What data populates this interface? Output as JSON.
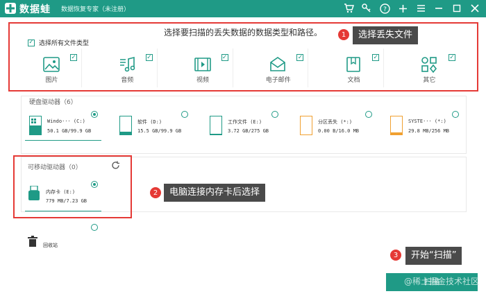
{
  "app": {
    "name": "数据蛙",
    "subtitle": "数据恢复专家（未注册）"
  },
  "titlebar": {
    "icons": [
      "cart-icon",
      "key-icon",
      "help-icon",
      "plus-icon",
      "menu-icon",
      "minimize-icon",
      "maximize-icon",
      "close-icon"
    ]
  },
  "scan": {
    "title": "选择要扫描的丢失数据的数据类型和路径。",
    "select_all": "选择所有文件类型",
    "types": [
      {
        "label": "图片",
        "icon": "image-icon",
        "checked": true
      },
      {
        "label": "音频",
        "icon": "music-icon",
        "checked": true
      },
      {
        "label": "视频",
        "icon": "video-icon",
        "checked": true
      },
      {
        "label": "电子邮件",
        "icon": "email-icon",
        "checked": true
      },
      {
        "label": "文档",
        "icon": "document-icon",
        "checked": true
      },
      {
        "label": "其它",
        "icon": "other-icon",
        "checked": true
      }
    ]
  },
  "hdd": {
    "title": "硬盘驱动器（6）",
    "drives": [
      {
        "name": "Windo··· (C:)",
        "size": "50.1 GB/99.9 GB",
        "selected": true,
        "fill": 0.5,
        "color": "#1f9a86",
        "windows": true
      },
      {
        "name": "软件 (D:)",
        "size": "15.5 GB/99.9 GB",
        "selected": false,
        "fill": 0.16,
        "color": "#1f9a86",
        "windows": false
      },
      {
        "name": "工作文件 (E:)",
        "size": "3.72 GB/275 GB",
        "selected": false,
        "fill": 0.01,
        "color": "#1f9a86",
        "windows": false
      },
      {
        "name": "分区丢失 (*:)",
        "size": "0.00  B/16.0 MB",
        "selected": false,
        "fill": 0.0,
        "color": "#f0a030",
        "windows": false
      },
      {
        "name": "SYSTE··· (*:)",
        "size": "29.8 MB/256 MB",
        "selected": false,
        "fill": 0.12,
        "color": "#f0a030",
        "windows": false
      }
    ]
  },
  "usb": {
    "title": "可移动驱动器（0）",
    "drives": [
      {
        "name": "内存卡 (E:)",
        "size": "779 MB/7.23 GB",
        "selected": true
      }
    ]
  },
  "recycle_bin": {
    "label": "回收站"
  },
  "scan_button": {
    "label": "扫描"
  },
  "annotations": [
    {
      "num": "1",
      "text": "选择丢失文件"
    },
    {
      "num": "2",
      "text": "电脑连接内存卡后选择"
    },
    {
      "num": "3",
      "text": "开始“扫描”"
    }
  ],
  "watermark": "@稀土掘金技术社区",
  "colors": {
    "accent": "#1f9a86",
    "annotation": "#e53935",
    "warning": "#f0a030"
  }
}
